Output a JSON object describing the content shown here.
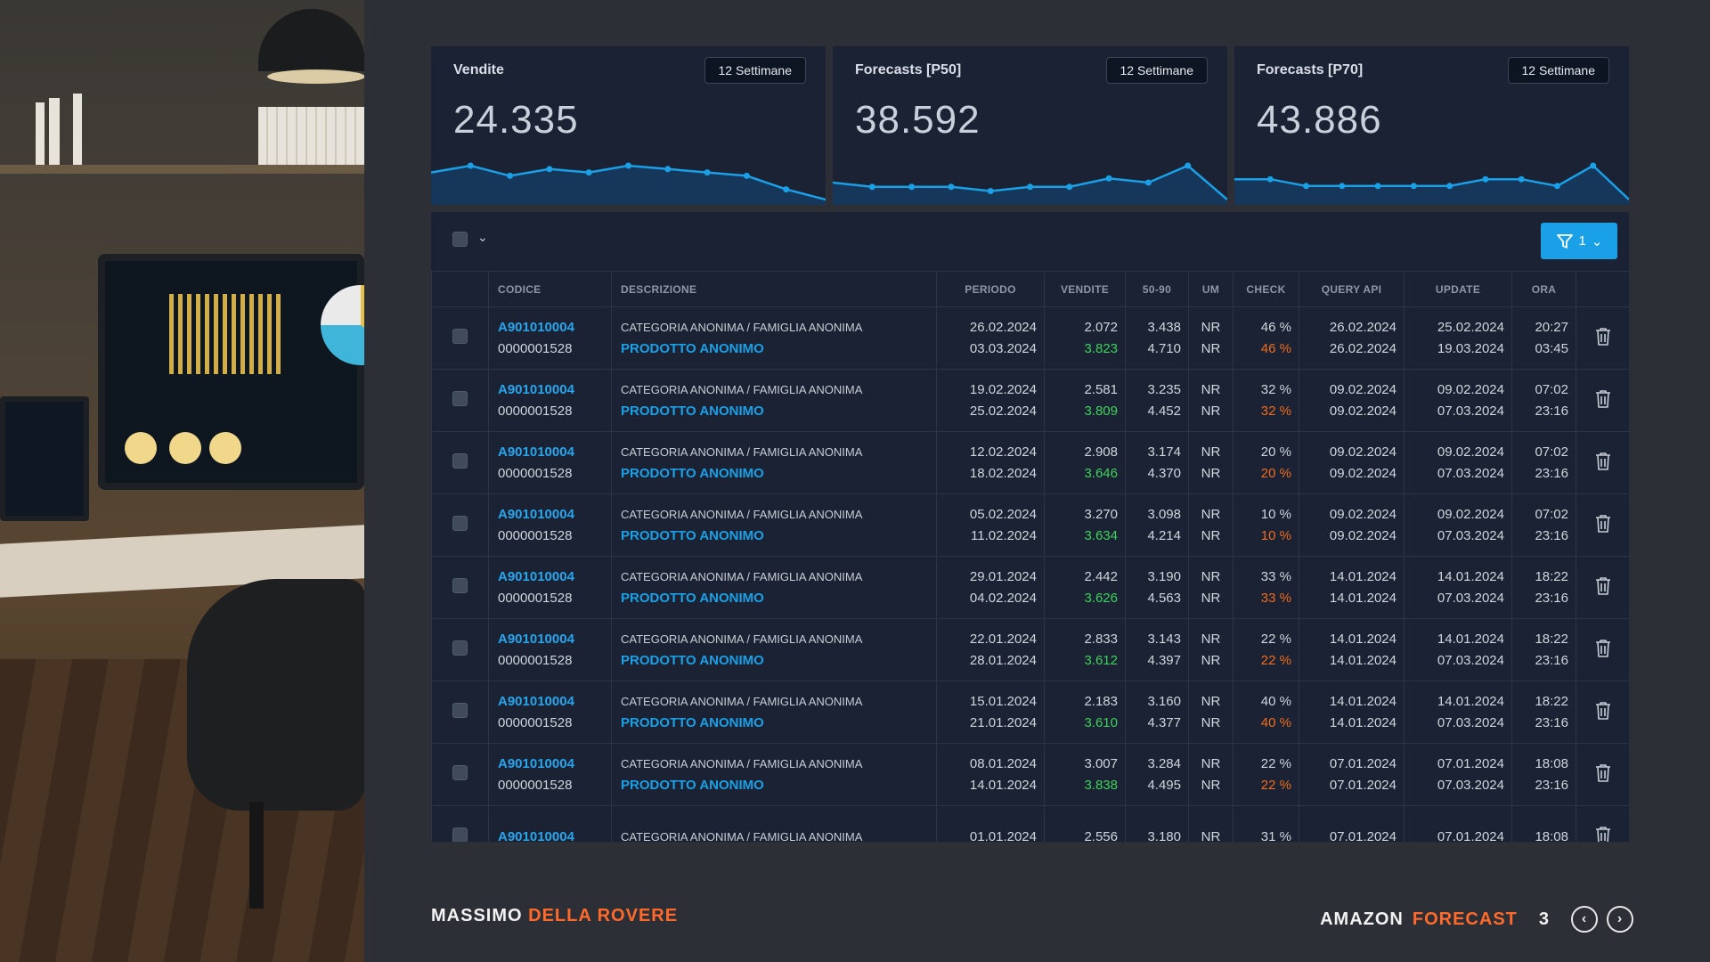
{
  "kpis": [
    {
      "title": "Vendite",
      "button": "12 Settimane",
      "value": "24.335",
      "spark": [
        6,
        8,
        5,
        7,
        6,
        8,
        7,
        6,
        5,
        1,
        -2
      ]
    },
    {
      "title": "Forecasts [P50]",
      "button": "12 Settimane",
      "value": "38.592",
      "spark": [
        5,
        4,
        4,
        4,
        3,
        4,
        4,
        6,
        5,
        9,
        1
      ]
    },
    {
      "title": "Forecasts [P70]",
      "button": "12 Settimane",
      "value": "43.886",
      "spark": [
        5,
        5,
        4,
        4,
        4,
        4,
        4,
        5,
        5,
        4,
        7,
        2
      ]
    }
  ],
  "colors": {
    "accent": "#1aa0e6",
    "brand_orange": "#ff6a2b",
    "green": "#3fd25c",
    "orange_text": "#f06c1e"
  },
  "toolbar": {
    "filter_count": "1"
  },
  "table": {
    "headers": {
      "codice": "CODICE",
      "descrizione": "DESCRIZIONE",
      "periodo": "PERIODO",
      "vendite": "VENDITE",
      "range": "50-90",
      "um": "UM",
      "check": "CHECK",
      "query_api": "QUERY API",
      "update": "UPDATE",
      "ora": "ORA"
    },
    "rows": [
      {
        "code": "A901010004",
        "code2": "0000001528",
        "cat": "CATEGORIA ANONIMA / FAMIGLIA ANONIMA",
        "prod": "PRODOTTO ANONIMO",
        "p1": "26.02.2024",
        "p2": "03.03.2024",
        "v1": "2.072",
        "v2": "3.823",
        "r1": "3.438",
        "r2": "4.710",
        "um1": "NR",
        "um2": "NR",
        "c1": "46 %",
        "c2": "46 %",
        "q1": "26.02.2024",
        "q2": "26.02.2024",
        "u1": "25.02.2024",
        "u2": "19.03.2024",
        "o1": "20:27",
        "o2": "03:45"
      },
      {
        "code": "A901010004",
        "code2": "0000001528",
        "cat": "CATEGORIA ANONIMA / FAMIGLIA ANONIMA",
        "prod": "PRODOTTO ANONIMO",
        "p1": "19.02.2024",
        "p2": "25.02.2024",
        "v1": "2.581",
        "v2": "3.809",
        "r1": "3.235",
        "r2": "4.452",
        "um1": "NR",
        "um2": "NR",
        "c1": "32 %",
        "c2": "32 %",
        "q1": "09.02.2024",
        "q2": "09.02.2024",
        "u1": "09.02.2024",
        "u2": "07.03.2024",
        "o1": "07:02",
        "o2": "23:16"
      },
      {
        "code": "A901010004",
        "code2": "0000001528",
        "cat": "CATEGORIA ANONIMA / FAMIGLIA ANONIMA",
        "prod": "PRODOTTO ANONIMO",
        "p1": "12.02.2024",
        "p2": "18.02.2024",
        "v1": "2.908",
        "v2": "3.646",
        "r1": "3.174",
        "r2": "4.370",
        "um1": "NR",
        "um2": "NR",
        "c1": "20 %",
        "c2": "20 %",
        "q1": "09.02.2024",
        "q2": "09.02.2024",
        "u1": "09.02.2024",
        "u2": "07.03.2024",
        "o1": "07:02",
        "o2": "23:16"
      },
      {
        "code": "A901010004",
        "code2": "0000001528",
        "cat": "CATEGORIA ANONIMA / FAMIGLIA ANONIMA",
        "prod": "PRODOTTO ANONIMO",
        "p1": "05.02.2024",
        "p2": "11.02.2024",
        "v1": "3.270",
        "v2": "3.634",
        "r1": "3.098",
        "r2": "4.214",
        "um1": "NR",
        "um2": "NR",
        "c1": "10 %",
        "c2": "10 %",
        "q1": "09.02.2024",
        "q2": "09.02.2024",
        "u1": "09.02.2024",
        "u2": "07.03.2024",
        "o1": "07:02",
        "o2": "23:16"
      },
      {
        "code": "A901010004",
        "code2": "0000001528",
        "cat": "CATEGORIA ANONIMA / FAMIGLIA ANONIMA",
        "prod": "PRODOTTO ANONIMO",
        "p1": "29.01.2024",
        "p2": "04.02.2024",
        "v1": "2.442",
        "v2": "3.626",
        "r1": "3.190",
        "r2": "4.563",
        "um1": "NR",
        "um2": "NR",
        "c1": "33 %",
        "c2": "33 %",
        "q1": "14.01.2024",
        "q2": "14.01.2024",
        "u1": "14.01.2024",
        "u2": "07.03.2024",
        "o1": "18:22",
        "o2": "23:16"
      },
      {
        "code": "A901010004",
        "code2": "0000001528",
        "cat": "CATEGORIA ANONIMA / FAMIGLIA ANONIMA",
        "prod": "PRODOTTO ANONIMO",
        "p1": "22.01.2024",
        "p2": "28.01.2024",
        "v1": "2.833",
        "v2": "3.612",
        "r1": "3.143",
        "r2": "4.397",
        "um1": "NR",
        "um2": "NR",
        "c1": "22 %",
        "c2": "22 %",
        "q1": "14.01.2024",
        "q2": "14.01.2024",
        "u1": "14.01.2024",
        "u2": "07.03.2024",
        "o1": "18:22",
        "o2": "23:16"
      },
      {
        "code": "A901010004",
        "code2": "0000001528",
        "cat": "CATEGORIA ANONIMA / FAMIGLIA ANONIMA",
        "prod": "PRODOTTO ANONIMO",
        "p1": "15.01.2024",
        "p2": "21.01.2024",
        "v1": "2.183",
        "v2": "3.610",
        "r1": "3.160",
        "r2": "4.377",
        "um1": "NR",
        "um2": "NR",
        "c1": "40 %",
        "c2": "40 %",
        "q1": "14.01.2024",
        "q2": "14.01.2024",
        "u1": "14.01.2024",
        "u2": "07.03.2024",
        "o1": "18:22",
        "o2": "23:16"
      },
      {
        "code": "A901010004",
        "code2": "0000001528",
        "cat": "CATEGORIA ANONIMA / FAMIGLIA ANONIMA",
        "prod": "PRODOTTO ANONIMO",
        "p1": "08.01.2024",
        "p2": "14.01.2024",
        "v1": "3.007",
        "v2": "3.838",
        "r1": "3.284",
        "r2": "4.495",
        "um1": "NR",
        "um2": "NR",
        "c1": "22 %",
        "c2": "22 %",
        "q1": "07.01.2024",
        "q2": "07.01.2024",
        "u1": "07.01.2024",
        "u2": "07.03.2024",
        "o1": "18:08",
        "o2": "23:16"
      },
      {
        "code": "A901010004",
        "code2": "",
        "cat": "CATEGORIA ANONIMA / FAMIGLIA ANONIMA",
        "prod": "",
        "p1": "01.01.2024",
        "p2": "",
        "v1": "2.556",
        "v2": "",
        "r1": "3.180",
        "r2": "",
        "um1": "NR",
        "um2": "",
        "c1": "31 %",
        "c2": "",
        "q1": "07.01.2024",
        "q2": "",
        "u1": "07.01.2024",
        "u2": "",
        "o1": "18:08",
        "o2": ""
      }
    ]
  },
  "footer": {
    "author_first": "MASSIMO",
    "author_last": "DELLA ROVERE",
    "brand_first": "AMAZON",
    "brand_second": "FORECAST",
    "page": "3",
    "prev_icon": "chevron-left-icon",
    "next_icon": "chevron-right-icon"
  }
}
